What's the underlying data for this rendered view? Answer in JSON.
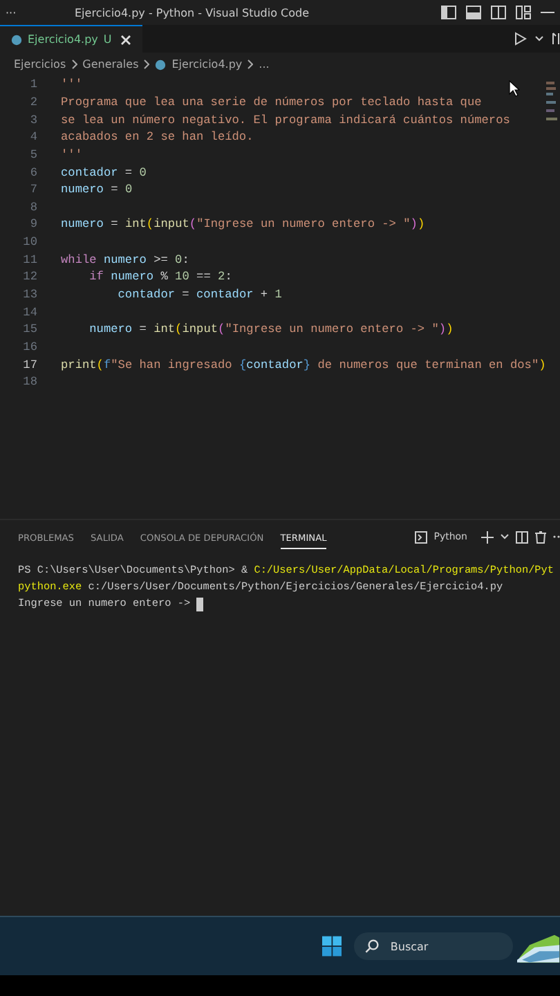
{
  "window": {
    "title": "Ejercicio4.py - Python - Visual Studio Code",
    "menu": "···"
  },
  "tabs": [
    {
      "label": "Ejercicio4.py",
      "status": "U",
      "selected": true
    }
  ],
  "breadcrumb": [
    "Ejercicios",
    "Generales",
    "Ejercicio4.py",
    "..."
  ],
  "editor": {
    "lines": [
      {
        "number": "1",
        "selected": false,
        "tokens": [
          {
            "t": "'''",
            "kind": "str"
          }
        ]
      },
      {
        "number": "2",
        "selected": false,
        "tokens": [
          {
            "t": "Programa que lea una serie de números por teclado hasta que",
            "kind": "str"
          }
        ]
      },
      {
        "number": "3",
        "selected": false,
        "tokens": [
          {
            "t": "se lea un número negativo. El programa indicará cuántos números",
            "kind": "str"
          }
        ]
      },
      {
        "number": "4",
        "selected": false,
        "tokens": [
          {
            "t": "acabados en 2 se han leído.",
            "kind": "str"
          }
        ]
      },
      {
        "number": "5",
        "selected": false,
        "tokens": [
          {
            "t": "'''",
            "kind": "str"
          }
        ]
      },
      {
        "number": "6",
        "selected": false,
        "tokens": [
          {
            "t": "contador",
            "kind": "var"
          },
          {
            "t": " = ",
            "kind": "op"
          },
          {
            "t": "0",
            "kind": "num"
          }
        ]
      },
      {
        "number": "7",
        "selected": false,
        "tokens": [
          {
            "t": "numero",
            "kind": "var"
          },
          {
            "t": " = ",
            "kind": "op"
          },
          {
            "t": "0",
            "kind": "num"
          }
        ]
      },
      {
        "number": "8",
        "selected": false
      },
      {
        "number": "9",
        "selected": false,
        "tokens": [
          {
            "t": "numero",
            "kind": "var"
          },
          {
            "t": " = ",
            "kind": "op"
          },
          {
            "t": "int",
            "kind": "fn"
          },
          {
            "t": "(",
            "kind": "paren"
          },
          {
            "t": "input",
            "kind": "fn"
          },
          {
            "t": "(",
            "kind": "paren2"
          },
          {
            "t": "\"Ingrese un numero entero -> \"",
            "kind": "str"
          },
          {
            "t": ")",
            "kind": "paren2"
          },
          {
            "t": ")",
            "kind": "paren"
          }
        ]
      },
      {
        "number": "10",
        "selected": false
      },
      {
        "number": "11",
        "selected": false,
        "tokens": [
          {
            "t": "while",
            "kind": "kw"
          },
          {
            "t": " numero",
            "kind": "var"
          },
          {
            "t": " >= ",
            "kind": "op"
          },
          {
            "t": "0",
            "kind": "num"
          },
          {
            "t": ":",
            "kind": "op"
          }
        ]
      },
      {
        "number": "12",
        "selected": false,
        "tokens": [
          {
            "t": "    if",
            "kind": "kw"
          },
          {
            "t": " numero",
            "kind": "var"
          },
          {
            "t": " % ",
            "kind": "op"
          },
          {
            "t": "10",
            "kind": "num"
          },
          {
            "t": " == ",
            "kind": "op"
          },
          {
            "t": "2",
            "kind": "num"
          },
          {
            "t": ":",
            "kind": "op"
          }
        ]
      },
      {
        "number": "13",
        "selected": false,
        "tokens": [
          {
            "t": "        contador",
            "kind": "var"
          },
          {
            "t": " = ",
            "kind": "op"
          },
          {
            "t": "contador",
            "kind": "var"
          },
          {
            "t": " + ",
            "kind": "op"
          },
          {
            "t": "1",
            "kind": "num"
          }
        ]
      },
      {
        "number": "14",
        "selected": false
      },
      {
        "number": "15",
        "selected": false,
        "tokens": [
          {
            "t": "    numero",
            "kind": "var"
          },
          {
            "t": " = ",
            "kind": "op"
          },
          {
            "t": "int",
            "kind": "fn"
          },
          {
            "t": "(",
            "kind": "paren"
          },
          {
            "t": "input",
            "kind": "fn"
          },
          {
            "t": "(",
            "kind": "paren2"
          },
          {
            "t": "\"Ingrese un numero entero -> \"",
            "kind": "str"
          },
          {
            "t": ")",
            "kind": "paren2"
          },
          {
            "t": ")",
            "kind": "paren"
          }
        ]
      },
      {
        "number": "16",
        "selected": false
      },
      {
        "number": "17",
        "selected": true,
        "tokens": [
          {
            "t": "print",
            "kind": "fn"
          },
          {
            "t": "(",
            "kind": "paren"
          },
          {
            "t": "f",
            "kind": "fprefix"
          },
          {
            "t": "\"Se han ingresado ",
            "kind": "str"
          },
          {
            "t": "{",
            "kind": "fbrace"
          },
          {
            "t": "contador",
            "kind": "var"
          },
          {
            "t": "}",
            "kind": "fbrace"
          },
          {
            "t": " de numeros que terminan en dos\"",
            "kind": "str"
          },
          {
            "t": ")",
            "kind": "paren"
          }
        ]
      },
      {
        "number": "18",
        "selected": false
      }
    ]
  },
  "panel": {
    "tabs": [
      {
        "label": "PROBLEMAS",
        "selected": false
      },
      {
        "label": "SALIDA",
        "selected": false
      },
      {
        "label": "CONSOLA DE DEPURACIÓN",
        "selected": false
      },
      {
        "label": "TERMINAL",
        "selected": true
      }
    ],
    "shell": "Python",
    "terminal": [
      {
        "tokens": [
          {
            "t": "PS C:\\Users\\User\\Documents\\Python> & ",
            "kind": "plain"
          },
          {
            "t": "C:/Users/User/AppData/Local/Programs/Python/Pyt",
            "kind": "path"
          }
        ],
        "cursor": false
      },
      {
        "tokens": [
          {
            "t": "python.exe",
            "kind": "path"
          },
          {
            "t": " c:/Users/User/Documents/Python/Ejercicios/Generales/Ejercicio4.py",
            "kind": "plain"
          }
        ],
        "cursor": false
      },
      {
        "tokens": [
          {
            "t": "Ingrese un numero entero -> ",
            "kind": "plain"
          }
        ],
        "cursor": true
      }
    ]
  },
  "taskbar": {
    "search": {
      "placeholder": "Buscar"
    }
  }
}
